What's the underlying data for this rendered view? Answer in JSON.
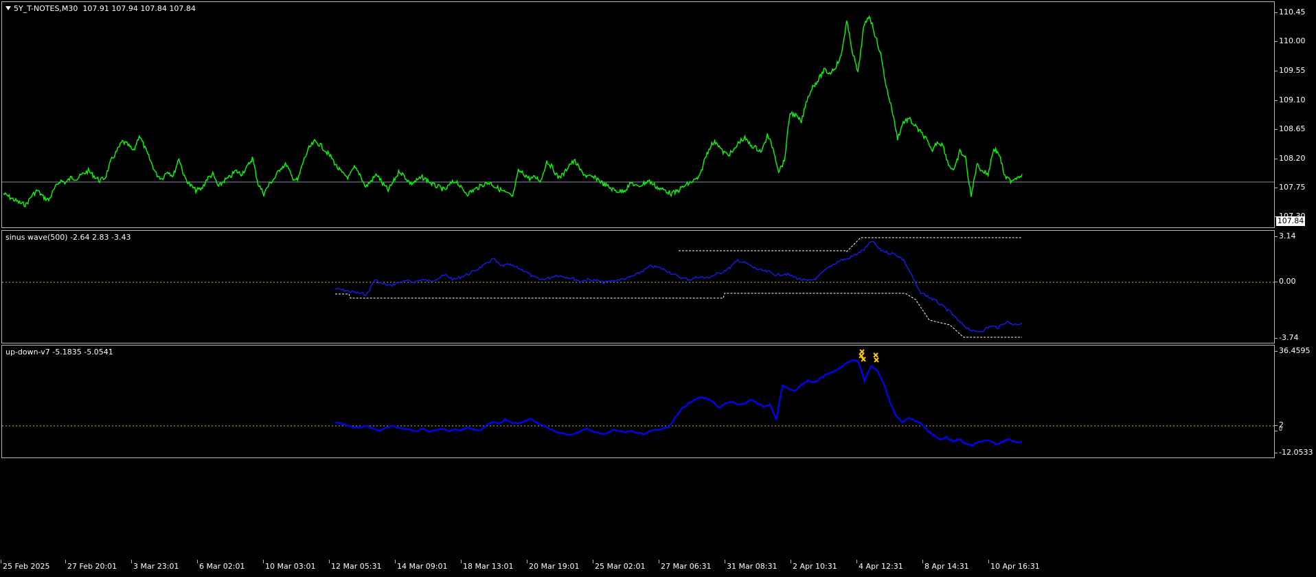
{
  "colors": {
    "price": "#00ff00",
    "sine": "#1a1aff",
    "updown": "#0000ff",
    "level": "#c8c800",
    "bid": "#8a8fa8",
    "marker": "#ffcc00"
  },
  "price_pane": {
    "symbol": "5Y_T-NOTES,M30",
    "ohlc": "107.91 107.94 107.84 107.84",
    "ticks": [
      "110.45",
      "110.00",
      "109.55",
      "109.10",
      "108.65",
      "108.20",
      "107.75",
      "107.30"
    ],
    "current": "107.84",
    "series": [
      107.65,
      107.6,
      107.55,
      107.5,
      107.48,
      107.62,
      107.7,
      107.6,
      107.55,
      107.72,
      107.85,
      107.82,
      107.9,
      107.88,
      107.95,
      108.0,
      107.92,
      107.85,
      107.9,
      108.15,
      108.3,
      108.45,
      108.4,
      108.3,
      108.55,
      108.35,
      108.15,
      107.95,
      107.88,
      108.0,
      107.92,
      108.2,
      107.9,
      107.78,
      107.7,
      107.72,
      107.88,
      107.95,
      107.75,
      107.85,
      107.9,
      108.0,
      107.95,
      108.05,
      108.2,
      107.8,
      107.65,
      107.8,
      107.9,
      108.05,
      108.1,
      107.9,
      107.85,
      108.15,
      108.35,
      108.45,
      108.4,
      108.3,
      108.2,
      108.05,
      107.95,
      107.9,
      108.05,
      107.95,
      107.75,
      107.85,
      107.95,
      107.8,
      107.7,
      107.85,
      108.0,
      107.9,
      107.8,
      107.85,
      107.9,
      107.85,
      107.78,
      107.75,
      107.7,
      107.8,
      107.85,
      107.72,
      107.65,
      107.7,
      107.75,
      107.8,
      107.82,
      107.75,
      107.7,
      107.65,
      107.6,
      108.0,
      107.95,
      107.88,
      107.9,
      107.85,
      108.15,
      108.05,
      107.9,
      107.95,
      108.1,
      108.15,
      108.0,
      107.92,
      107.9,
      107.88,
      107.8,
      107.75,
      107.7,
      107.68,
      107.72,
      107.82,
      107.75,
      107.8,
      107.85,
      107.78,
      107.72,
      107.7,
      107.65,
      107.68,
      107.75,
      107.8,
      107.85,
      107.9,
      108.2,
      108.4,
      108.45,
      108.3,
      108.25,
      108.3,
      108.45,
      108.5,
      108.4,
      108.35,
      108.3,
      108.55,
      108.35,
      108.0,
      108.15,
      108.9,
      108.85,
      108.75,
      109.1,
      109.3,
      109.4,
      109.55,
      109.5,
      109.6,
      109.75,
      110.3,
      109.85,
      109.5,
      110.2,
      110.4,
      110.1,
      109.8,
      109.3,
      108.95,
      108.5,
      108.75,
      108.8,
      108.7,
      108.6,
      108.5,
      108.3,
      108.45,
      108.4,
      108.1,
      108.0,
      108.3,
      108.2,
      107.6,
      108.1,
      108.0,
      107.95,
      108.35,
      108.25,
      107.9,
      107.85,
      107.9,
      107.95
    ]
  },
  "sine_pane": {
    "name": "sinus wave(500)",
    "values": "-2.64 2.83 -3.43",
    "ticks": [
      "3.14",
      "0.00",
      "-3.74"
    ],
    "series": [
      -0.4,
      -0.5,
      -0.6,
      -0.7,
      -0.8,
      0.2,
      -0.1,
      -0.2,
      0.0,
      0.1,
      0.05,
      0.2,
      0.1,
      0.3,
      0.5,
      0.2,
      0.4,
      0.6,
      0.9,
      1.2,
      1.6,
      1.1,
      1.2,
      1.0,
      0.8,
      0.4,
      0.2,
      0.3,
      0.5,
      0.4,
      0.3,
      0.1,
      0.2,
      0.15,
      0.0,
      0.1,
      0.2,
      0.3,
      0.5,
      0.8,
      1.1,
      1.0,
      0.8,
      0.5,
      0.3,
      0.2,
      0.4,
      0.3,
      0.5,
      0.7,
      1.0,
      1.5,
      1.3,
      1.0,
      0.8,
      0.7,
      0.5,
      0.6,
      0.4,
      0.2,
      0.1,
      0.3,
      0.8,
      1.2,
      1.5,
      1.6,
      1.9,
      2.2,
      2.8,
      2.2,
      2.0,
      1.9,
      1.5,
      0.5,
      -0.6,
      -0.9,
      -1.2,
      -1.6,
      -2.0,
      -2.6,
      -3.0,
      -3.3,
      -3.2,
      -2.9,
      -3.0,
      -2.6,
      -2.8,
      -2.7
    ]
  },
  "updown_pane": {
    "name": "up-down-v7",
    "values": "-5.1835 -5.0541",
    "ticks": [
      "36.4595",
      "2",
      "0",
      "-12.0533"
    ],
    "series": [
      2.0,
      1.5,
      0.5,
      -0.5,
      -0.2,
      0.5,
      -1.0,
      -2.0,
      -0.5,
      0.3,
      -0.5,
      -1.0,
      -1.5,
      -2.0,
      -1.0,
      -2.5,
      -1.5,
      -1.0,
      -2.0,
      -1.5,
      -1.8,
      -0.5,
      -1.5,
      -2.0,
      1.0,
      2.0,
      1.5,
      3.5,
      2.0,
      1.8,
      2.5,
      4.0,
      1.8,
      0.5,
      -1.0,
      -2.5,
      -3.0,
      -4.0,
      -3.5,
      -2.0,
      -1.0,
      -2.5,
      -3.0,
      -3.5,
      -1.5,
      -2.0,
      -2.5,
      -2.0,
      -3.0,
      -3.5,
      -2.0,
      -1.5,
      -1.0,
      0.0,
      4.5,
      8.5,
      11.0,
      13.0,
      14.0,
      13.5,
      11.5,
      9.0,
      11.0,
      12.0,
      10.5,
      11.0,
      13.0,
      11.0,
      9.5,
      10.5,
      3.5,
      20.0,
      18.0,
      17.0,
      20.0,
      22.0,
      21.0,
      23.0,
      25.0,
      26.0,
      28.0,
      30.0,
      32.0,
      31.0,
      22.0,
      29.0,
      27.0,
      21.0,
      12.0,
      5.0,
      2.0,
      4.0,
      3.0,
      1.5,
      -2.0,
      -4.0,
      -6.0,
      -5.0,
      -7.0,
      -6.0,
      -8.0,
      -9.0,
      -7.5,
      -6.5,
      -7.0,
      -8.5,
      -7.0,
      -6.0,
      -7.5,
      -7.0
    ]
  },
  "time_axis": [
    "25 Feb 2025",
    "27 Feb 20:01",
    "3 Mar 23:01",
    "6 Mar 02:01",
    "10 Mar 03:01",
    "12 Mar 05:31",
    "14 Mar 09:01",
    "18 Mar 13:01",
    "20 Mar 19:01",
    "25 Mar 02:01",
    "27 Mar 06:31",
    "31 Mar 08:31",
    "2 Apr 10:31",
    "4 Apr 12:31",
    "8 Apr 14:31",
    "10 Apr 16:31"
  ]
}
